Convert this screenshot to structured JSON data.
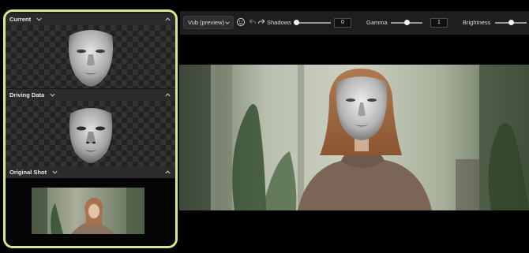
{
  "left_panel": {
    "sections": [
      {
        "label": "Current"
      },
      {
        "label": "Driving Data"
      },
      {
        "label": "Original Shot"
      }
    ]
  },
  "toolbar": {
    "version_select": "Vub (preview)",
    "shadows_label": "Shadows",
    "shadows_value": "0",
    "gamma_label": "Gamma",
    "gamma_value": "1",
    "brightness_label": "Brightness",
    "shadows_level": 0.0,
    "gamma_level": 0.5,
    "brightness_level": 0.5
  },
  "colors": {
    "panel_border": "#d4e98c",
    "panel_bg": "#1a1a1a",
    "header_bg": "#2b2b2b",
    "toolbar_bg": "#1e1e1e"
  }
}
